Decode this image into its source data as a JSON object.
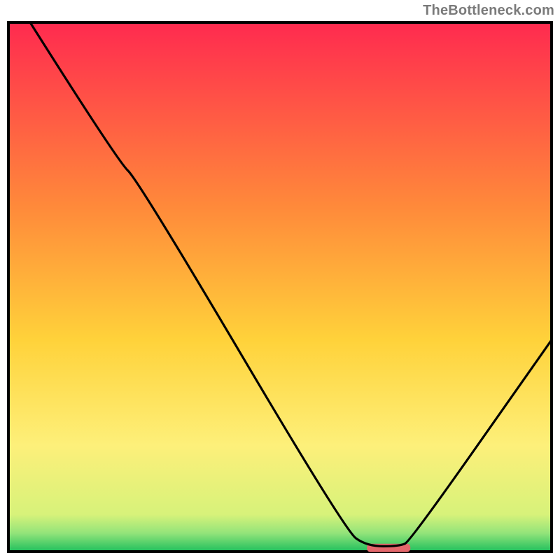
{
  "watermark": "TheBottleneck.com",
  "chart_data": {
    "type": "line",
    "title": "",
    "xlabel": "",
    "ylabel": "",
    "xlim": [
      0,
      100
    ],
    "ylim": [
      0,
      100
    ],
    "grid": false,
    "legend": false,
    "notes": "V-shaped bottleneck curve over a vertical gradient (red→yellow→green). A short red marker segment sits at/near the curve minimum on the x-axis. Axes have no visible tick labels — values below are estimated relative positions.",
    "curve": {
      "name": "bottleneck-curve",
      "color": "#000000",
      "points_xy": [
        [
          4,
          100
        ],
        [
          20,
          74
        ],
        [
          24,
          70
        ],
        [
          62,
          4
        ],
        [
          66,
          1
        ],
        [
          72,
          1
        ],
        [
          74,
          2
        ],
        [
          100,
          40
        ]
      ]
    },
    "marker": {
      "name": "optimal-segment",
      "color": "#e4676b",
      "x_range": [
        66,
        74
      ],
      "y": 0.7
    },
    "gradient_stops": [
      {
        "offset": 0.0,
        "color": "#ff2a4f"
      },
      {
        "offset": 0.35,
        "color": "#ff8a3a"
      },
      {
        "offset": 0.6,
        "color": "#ffd23a"
      },
      {
        "offset": 0.8,
        "color": "#fdf07a"
      },
      {
        "offset": 0.93,
        "color": "#d7f27a"
      },
      {
        "offset": 0.965,
        "color": "#93e47a"
      },
      {
        "offset": 1.0,
        "color": "#1fbf5d"
      }
    ],
    "frame_color": "#000000",
    "frame_width": 4
  }
}
